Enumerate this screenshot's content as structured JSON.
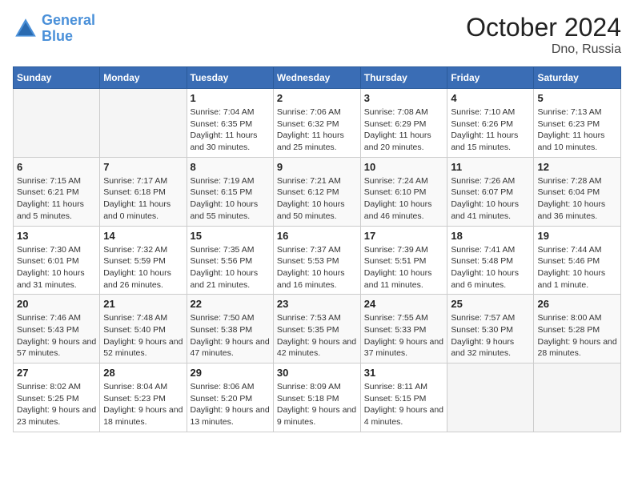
{
  "header": {
    "logo_line1": "General",
    "logo_line2": "Blue",
    "month": "October 2024",
    "location": "Dno, Russia"
  },
  "weekdays": [
    "Sunday",
    "Monday",
    "Tuesday",
    "Wednesday",
    "Thursday",
    "Friday",
    "Saturday"
  ],
  "weeks": [
    [
      {
        "day": "",
        "empty": true
      },
      {
        "day": "",
        "empty": true
      },
      {
        "day": "1",
        "sunrise": "Sunrise: 7:04 AM",
        "sunset": "Sunset: 6:35 PM",
        "daylight": "Daylight: 11 hours and 30 minutes."
      },
      {
        "day": "2",
        "sunrise": "Sunrise: 7:06 AM",
        "sunset": "Sunset: 6:32 PM",
        "daylight": "Daylight: 11 hours and 25 minutes."
      },
      {
        "day": "3",
        "sunrise": "Sunrise: 7:08 AM",
        "sunset": "Sunset: 6:29 PM",
        "daylight": "Daylight: 11 hours and 20 minutes."
      },
      {
        "day": "4",
        "sunrise": "Sunrise: 7:10 AM",
        "sunset": "Sunset: 6:26 PM",
        "daylight": "Daylight: 11 hours and 15 minutes."
      },
      {
        "day": "5",
        "sunrise": "Sunrise: 7:13 AM",
        "sunset": "Sunset: 6:23 PM",
        "daylight": "Daylight: 11 hours and 10 minutes."
      }
    ],
    [
      {
        "day": "6",
        "sunrise": "Sunrise: 7:15 AM",
        "sunset": "Sunset: 6:21 PM",
        "daylight": "Daylight: 11 hours and 5 minutes."
      },
      {
        "day": "7",
        "sunrise": "Sunrise: 7:17 AM",
        "sunset": "Sunset: 6:18 PM",
        "daylight": "Daylight: 11 hours and 0 minutes."
      },
      {
        "day": "8",
        "sunrise": "Sunrise: 7:19 AM",
        "sunset": "Sunset: 6:15 PM",
        "daylight": "Daylight: 10 hours and 55 minutes."
      },
      {
        "day": "9",
        "sunrise": "Sunrise: 7:21 AM",
        "sunset": "Sunset: 6:12 PM",
        "daylight": "Daylight: 10 hours and 50 minutes."
      },
      {
        "day": "10",
        "sunrise": "Sunrise: 7:24 AM",
        "sunset": "Sunset: 6:10 PM",
        "daylight": "Daylight: 10 hours and 46 minutes."
      },
      {
        "day": "11",
        "sunrise": "Sunrise: 7:26 AM",
        "sunset": "Sunset: 6:07 PM",
        "daylight": "Daylight: 10 hours and 41 minutes."
      },
      {
        "day": "12",
        "sunrise": "Sunrise: 7:28 AM",
        "sunset": "Sunset: 6:04 PM",
        "daylight": "Daylight: 10 hours and 36 minutes."
      }
    ],
    [
      {
        "day": "13",
        "sunrise": "Sunrise: 7:30 AM",
        "sunset": "Sunset: 6:01 PM",
        "daylight": "Daylight: 10 hours and 31 minutes."
      },
      {
        "day": "14",
        "sunrise": "Sunrise: 7:32 AM",
        "sunset": "Sunset: 5:59 PM",
        "daylight": "Daylight: 10 hours and 26 minutes."
      },
      {
        "day": "15",
        "sunrise": "Sunrise: 7:35 AM",
        "sunset": "Sunset: 5:56 PM",
        "daylight": "Daylight: 10 hours and 21 minutes."
      },
      {
        "day": "16",
        "sunrise": "Sunrise: 7:37 AM",
        "sunset": "Sunset: 5:53 PM",
        "daylight": "Daylight: 10 hours and 16 minutes."
      },
      {
        "day": "17",
        "sunrise": "Sunrise: 7:39 AM",
        "sunset": "Sunset: 5:51 PM",
        "daylight": "Daylight: 10 hours and 11 minutes."
      },
      {
        "day": "18",
        "sunrise": "Sunrise: 7:41 AM",
        "sunset": "Sunset: 5:48 PM",
        "daylight": "Daylight: 10 hours and 6 minutes."
      },
      {
        "day": "19",
        "sunrise": "Sunrise: 7:44 AM",
        "sunset": "Sunset: 5:46 PM",
        "daylight": "Daylight: 10 hours and 1 minute."
      }
    ],
    [
      {
        "day": "20",
        "sunrise": "Sunrise: 7:46 AM",
        "sunset": "Sunset: 5:43 PM",
        "daylight": "Daylight: 9 hours and 57 minutes."
      },
      {
        "day": "21",
        "sunrise": "Sunrise: 7:48 AM",
        "sunset": "Sunset: 5:40 PM",
        "daylight": "Daylight: 9 hours and 52 minutes."
      },
      {
        "day": "22",
        "sunrise": "Sunrise: 7:50 AM",
        "sunset": "Sunset: 5:38 PM",
        "daylight": "Daylight: 9 hours and 47 minutes."
      },
      {
        "day": "23",
        "sunrise": "Sunrise: 7:53 AM",
        "sunset": "Sunset: 5:35 PM",
        "daylight": "Daylight: 9 hours and 42 minutes."
      },
      {
        "day": "24",
        "sunrise": "Sunrise: 7:55 AM",
        "sunset": "Sunset: 5:33 PM",
        "daylight": "Daylight: 9 hours and 37 minutes."
      },
      {
        "day": "25",
        "sunrise": "Sunrise: 7:57 AM",
        "sunset": "Sunset: 5:30 PM",
        "daylight": "Daylight: 9 hours and 32 minutes."
      },
      {
        "day": "26",
        "sunrise": "Sunrise: 8:00 AM",
        "sunset": "Sunset: 5:28 PM",
        "daylight": "Daylight: 9 hours and 28 minutes."
      }
    ],
    [
      {
        "day": "27",
        "sunrise": "Sunrise: 8:02 AM",
        "sunset": "Sunset: 5:25 PM",
        "daylight": "Daylight: 9 hours and 23 minutes."
      },
      {
        "day": "28",
        "sunrise": "Sunrise: 8:04 AM",
        "sunset": "Sunset: 5:23 PM",
        "daylight": "Daylight: 9 hours and 18 minutes."
      },
      {
        "day": "29",
        "sunrise": "Sunrise: 8:06 AM",
        "sunset": "Sunset: 5:20 PM",
        "daylight": "Daylight: 9 hours and 13 minutes."
      },
      {
        "day": "30",
        "sunrise": "Sunrise: 8:09 AM",
        "sunset": "Sunset: 5:18 PM",
        "daylight": "Daylight: 9 hours and 9 minutes."
      },
      {
        "day": "31",
        "sunrise": "Sunrise: 8:11 AM",
        "sunset": "Sunset: 5:15 PM",
        "daylight": "Daylight: 9 hours and 4 minutes."
      },
      {
        "day": "",
        "empty": true
      },
      {
        "day": "",
        "empty": true
      }
    ]
  ]
}
